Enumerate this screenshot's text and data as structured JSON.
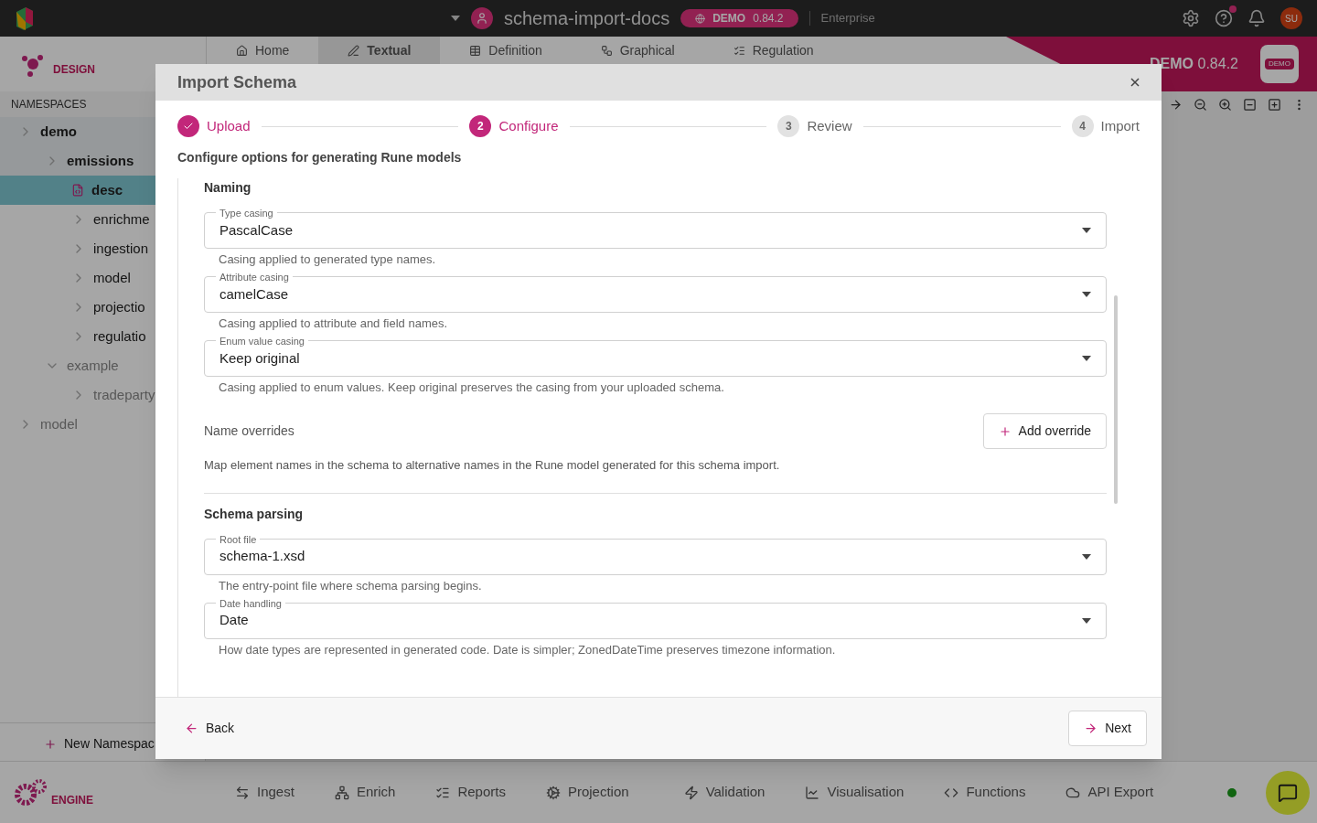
{
  "top_bar": {
    "project": "schema-import-docs",
    "env_label": "DEMO",
    "env_version": "0.84.2",
    "edition": "Enterprise",
    "avatar": "SU"
  },
  "design_logo": {
    "label": "DESIGN"
  },
  "tabs": [
    {
      "label": "Home",
      "selected": false
    },
    {
      "label": "Textual",
      "selected": true
    },
    {
      "label": "Definition",
      "selected": false
    },
    {
      "label": "Graphical",
      "selected": false
    },
    {
      "label": "Regulation",
      "selected": false
    }
  ],
  "env_banner": {
    "label": "DEMO",
    "version": "0.84.2",
    "logo": "DEMO"
  },
  "sidebar": {
    "heading": "NAMESPACES",
    "tree": [
      {
        "label": "demo",
        "expanded": false,
        "selected": false,
        "highlighted": true,
        "muted": false,
        "children": [
          {
            "label": "emissions",
            "expanded": false,
            "selected": false,
            "highlighted": true,
            "muted": false,
            "children": [
              {
                "label": "desc",
                "kind": "file",
                "selected": true,
                "muted": false
              },
              {
                "label": "enrichme",
                "expanded": false,
                "selected": false,
                "highlighted": false,
                "muted": false
              },
              {
                "label": "ingestion",
                "expanded": false,
                "selected": false,
                "highlighted": false,
                "muted": false
              },
              {
                "label": "model",
                "expanded": false,
                "selected": false,
                "highlighted": false,
                "muted": false
              },
              {
                "label": "projectio",
                "expanded": false,
                "selected": false,
                "highlighted": false,
                "muted": false
              },
              {
                "label": "regulatio",
                "expanded": false,
                "selected": false,
                "highlighted": false,
                "muted": false
              }
            ]
          },
          {
            "label": "example",
            "expanded": true,
            "selected": false,
            "highlighted": false,
            "muted": true,
            "children": [
              {
                "label": "tradeparty",
                "expanded": false,
                "selected": false,
                "highlighted": false,
                "muted": true
              }
            ]
          }
        ]
      },
      {
        "label": "model",
        "expanded": false,
        "selected": false,
        "highlighted": false,
        "muted": true
      }
    ],
    "new_button": "New Namespac"
  },
  "modal": {
    "title": "Import Schema",
    "steps": [
      {
        "label": "Upload",
        "done": true
      },
      {
        "number": "2",
        "label": "Configure",
        "done": false,
        "current": true
      },
      {
        "number": "3",
        "label": "Review",
        "done": false,
        "current": false
      },
      {
        "number": "4",
        "label": "Import",
        "done": false,
        "current": false
      }
    ],
    "subtitle": "Configure options for generating Rune models",
    "naming": {
      "title": "Naming",
      "fields": [
        {
          "label": "Type casing",
          "value": "PascalCase",
          "helper": "Casing applied to generated type names."
        },
        {
          "label": "Attribute casing",
          "value": "camelCase",
          "helper": "Casing applied to attribute and field names."
        },
        {
          "label": "Enum value casing",
          "value": "Keep original",
          "helper": "Casing applied to enum values. Keep original preserves the casing from your uploaded schema."
        }
      ]
    },
    "name_overrides": {
      "label": "Name overrides",
      "button": "Add override",
      "description": "Map element names in the schema to alternative names in the Rune model generated for this schema import."
    },
    "schema_parsing": {
      "title": "Schema parsing",
      "fields": [
        {
          "label": "Root file",
          "value": "schema-1.xsd",
          "helper": "The entry-point file where schema parsing begins."
        },
        {
          "label": "Date handling",
          "value": "Date",
          "helper": "How date types are represented in generated code. Date is simpler; ZonedDateTime preserves timezone information."
        }
      ]
    },
    "back": "Back",
    "next": "Next"
  },
  "engine_logo": {
    "label": "ENGINE"
  },
  "bottom_nav": [
    {
      "label": "Ingest",
      "kind": "ingest"
    },
    {
      "label": "Enrich",
      "kind": "enrich"
    },
    {
      "label": "Reports",
      "kind": "reports"
    },
    {
      "label": "Projection",
      "kind": "projection"
    },
    {
      "label": "Validation",
      "kind": "validation"
    },
    {
      "label": "Visualisation",
      "kind": "visualisation"
    },
    {
      "label": "Functions",
      "kind": "functions"
    },
    {
      "label": "API Export",
      "kind": "api"
    }
  ]
}
